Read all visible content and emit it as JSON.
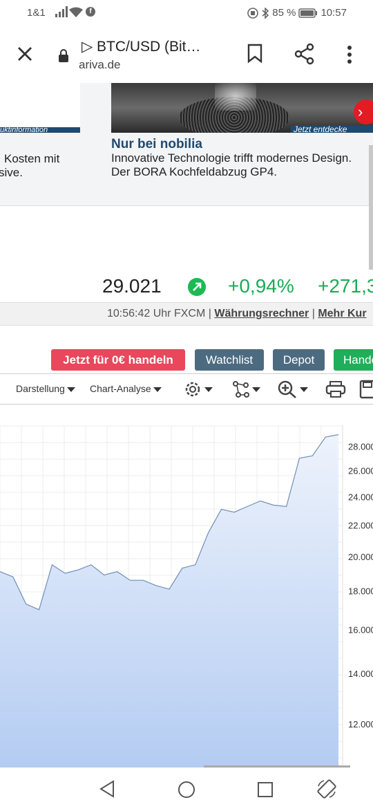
{
  "status_bar": {
    "carrier": "1&1",
    "battery": "85 %",
    "time": "10:57",
    "icons": [
      "signal-icon",
      "wifi-icon",
      "facebook-icon",
      "nfc-icon",
      "bluetooth-icon",
      "battery-icon"
    ]
  },
  "browser": {
    "page_title": "▷ BTC/USD (Bit…",
    "host": "ariva.de",
    "icons": [
      "close-icon",
      "lock-icon",
      "bookmark-icon",
      "share-icon",
      "more-icon"
    ]
  },
  "ad": {
    "left_strip": "uktinformation",
    "left_text_line1": "Kosten mit",
    "left_text_line2": "sive.",
    "right_strip": "Jetzt entdecke",
    "headline": "Nur bei nobilia",
    "desc_line1": "Innovative Technologie trifft modernes Design.",
    "desc_line2": "Der BORA Kochfeldabzug GP4.",
    "next_glyph": "›"
  },
  "quote": {
    "price": "29.021",
    "change_pct": "+0,94%",
    "change_abs": "+271,3",
    "time": "10:56:42 Uhr FXCM",
    "sep": "|",
    "link_converter": "Währungsrechner",
    "link_more": "Mehr Kur"
  },
  "actions": {
    "trade": "Jetzt für 0€ handeln",
    "watchlist": "Watchlist",
    "depot": "Depot",
    "handel": "Handel"
  },
  "chart_toolbar": {
    "darstellung": "Darstellung",
    "analyse": "Chart-Analyse",
    "icons": [
      "settings-icon",
      "indicators-icon",
      "zoom-in-icon",
      "print-icon",
      "save-icon"
    ]
  },
  "chart_data": {
    "type": "area",
    "title": "",
    "xlabel": "",
    "ylabel": "",
    "y_ticks": [
      "28.000",
      "26.000",
      "24.000",
      "22.000",
      "20.000",
      "18.000",
      "16.000",
      "14.000",
      "12.000"
    ],
    "ylim": [
      10500,
      29800
    ],
    "y_scale": "log",
    "grid": true,
    "colors": {
      "line": "#6f8fb5",
      "fill_top": "#eef3fc",
      "fill_bottom": "#b4ccf2"
    },
    "series": [
      {
        "values": [
          19100,
          18800,
          17300,
          17000,
          19500,
          19000,
          19200,
          19500,
          18900,
          19100,
          18600,
          18600,
          18300,
          18100,
          19300,
          19500,
          21500,
          23100,
          22900,
          23300,
          23700,
          23400,
          23300,
          27000,
          27200,
          28800,
          29021
        ]
      }
    ]
  },
  "navbar": {
    "icons": [
      "back-icon",
      "home-icon",
      "recents-icon",
      "rotate-icon"
    ]
  }
}
